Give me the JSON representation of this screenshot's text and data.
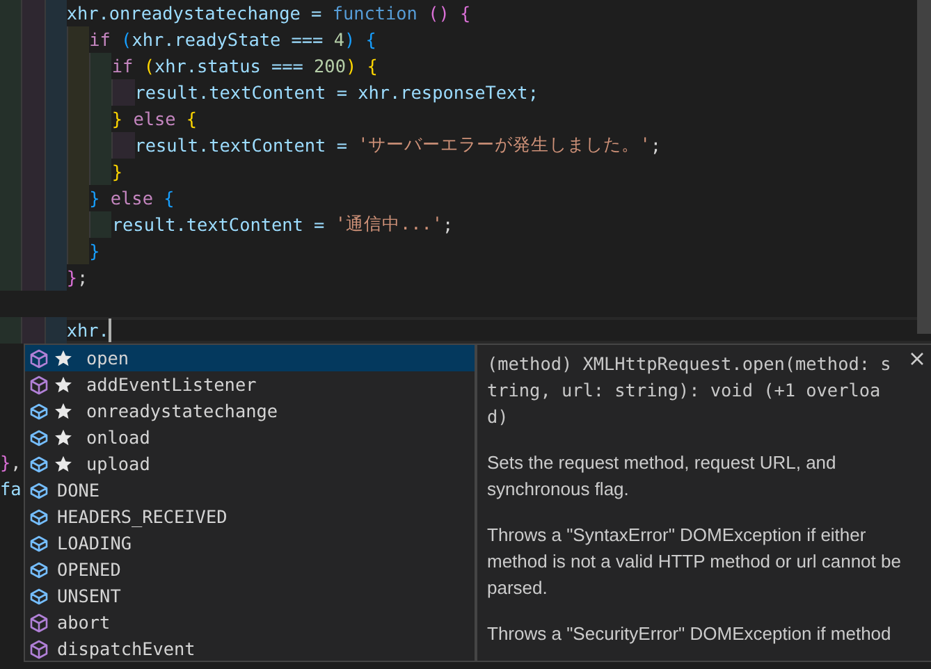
{
  "editor": {
    "lines": [
      {
        "tokens": [
          {
            "t": "      xhr.onreadystatechange = ",
            "color": "#9cdcfe"
          },
          {
            "t": "function ",
            "color": "#569cd6"
          },
          {
            "t": "() {",
            "color": "#da70d6"
          }
        ]
      },
      {
        "tokens": [
          {
            "t": "        if ",
            "color": "#c586c0"
          },
          {
            "t": "(",
            "color": "#179fff"
          },
          {
            "t": "xhr.readyState === ",
            "color": "#9cdcfe"
          },
          {
            "t": "4",
            "color": "#b5cea8"
          },
          {
            "t": ") {",
            "color": "#179fff"
          }
        ]
      },
      {
        "tokens": [
          {
            "t": "          if ",
            "color": "#c586c0"
          },
          {
            "t": "(",
            "color": "#ffd700"
          },
          {
            "t": "xhr.status === ",
            "color": "#9cdcfe"
          },
          {
            "t": "200",
            "color": "#b5cea8"
          },
          {
            "t": ") {",
            "color": "#ffd700"
          }
        ]
      },
      {
        "tokens": [
          {
            "t": "            result.textContent = xhr.responseText;",
            "color": "#9cdcfe"
          }
        ]
      },
      {
        "tokens": [
          {
            "t": "          } ",
            "color": "#ffd700"
          },
          {
            "t": "else ",
            "color": "#c586c0"
          },
          {
            "t": "{",
            "color": "#ffd700"
          }
        ]
      },
      {
        "tokens": [
          {
            "t": "            result.textContent = ",
            "color": "#9cdcfe"
          },
          {
            "t": "'サーバーエラーが発生しました。'",
            "color": "#ce9178"
          },
          {
            "t": ";",
            "color": "#d4d4d4"
          }
        ]
      },
      {
        "tokens": [
          {
            "t": "          }",
            "color": "#ffd700"
          }
        ]
      },
      {
        "tokens": [
          {
            "t": "        } ",
            "color": "#179fff"
          },
          {
            "t": "else ",
            "color": "#c586c0"
          },
          {
            "t": "{",
            "color": "#179fff"
          }
        ]
      },
      {
        "tokens": [
          {
            "t": "          result.textContent = ",
            "color": "#9cdcfe"
          },
          {
            "t": "'通信中...'",
            "color": "#ce9178"
          },
          {
            "t": ";",
            "color": "#d4d4d4"
          }
        ]
      },
      {
        "tokens": [
          {
            "t": "        }",
            "color": "#179fff"
          }
        ]
      },
      {
        "tokens": [
          {
            "t": "      }",
            "color": "#da70d6"
          },
          {
            "t": ";",
            "color": "#d4d4d4"
          }
        ]
      }
    ],
    "current_line": {
      "tokens": [
        {
          "t": "      xhr.",
          "color": "#9cdcfe"
        }
      ],
      "cursor": true
    },
    "lines_beside_popup": [
      {
        "tokens": [
          {
            "t": "}",
            "color": "#da70d6"
          },
          {
            "t": ",",
            "color": "#d4d4d4"
          }
        ]
      },
      {
        "tokens": [
          {
            "t": "fa",
            "color": "#9cdcfe"
          }
        ]
      }
    ]
  },
  "suggestions": [
    {
      "label": "open",
      "kind": "method",
      "starred": true,
      "selected": true
    },
    {
      "label": "addEventListener",
      "kind": "method",
      "starred": true,
      "selected": false
    },
    {
      "label": "onreadystatechange",
      "kind": "field",
      "starred": true,
      "selected": false
    },
    {
      "label": "onload",
      "kind": "field",
      "starred": true,
      "selected": false
    },
    {
      "label": "upload",
      "kind": "field",
      "starred": true,
      "selected": false
    },
    {
      "label": "DONE",
      "kind": "field",
      "starred": false,
      "selected": false
    },
    {
      "label": "HEADERS_RECEIVED",
      "kind": "field",
      "starred": false,
      "selected": false
    },
    {
      "label": "LOADING",
      "kind": "field",
      "starred": false,
      "selected": false
    },
    {
      "label": "OPENED",
      "kind": "field",
      "starred": false,
      "selected": false
    },
    {
      "label": "UNSENT",
      "kind": "field",
      "starred": false,
      "selected": false
    },
    {
      "label": "abort",
      "kind": "method",
      "starred": false,
      "selected": false
    },
    {
      "label": "dispatchEvent",
      "kind": "method",
      "starred": false,
      "selected": false
    }
  ],
  "details": {
    "signature": "(method) XMLHttpRequest.open(method: string, url: string): void (+1 overload)",
    "paragraphs": [
      "Sets the request method, request URL, and synchronous flag.",
      "Throws a \"SyntaxError\" DOMException if either method is not a valid HTTP method or url cannot be parsed.",
      "Throws a \"SecurityError\" DOMException if method"
    ]
  }
}
